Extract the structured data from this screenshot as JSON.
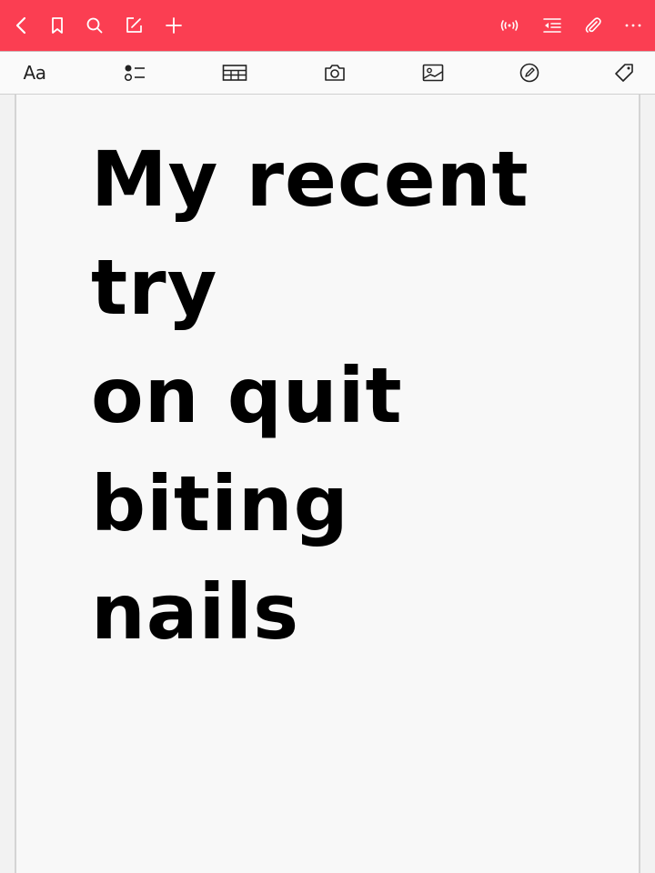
{
  "theme": {
    "accent": "#fb3e52"
  },
  "topbar": {
    "icons": [
      "back-icon",
      "bookmark-icon",
      "search-icon",
      "edit-icon",
      "add-icon",
      "audio-icon",
      "outdent-icon",
      "attachment-icon",
      "more-icon"
    ]
  },
  "toolbar": {
    "format_label": "Aa",
    "icons": [
      "format-icon",
      "checklist-icon",
      "table-icon",
      "camera-icon",
      "image-icon",
      "sketch-icon",
      "tag-icon"
    ]
  },
  "note": {
    "title_lines": [
      "My recent",
      "try",
      "on quit",
      "biting",
      "nails"
    ]
  }
}
